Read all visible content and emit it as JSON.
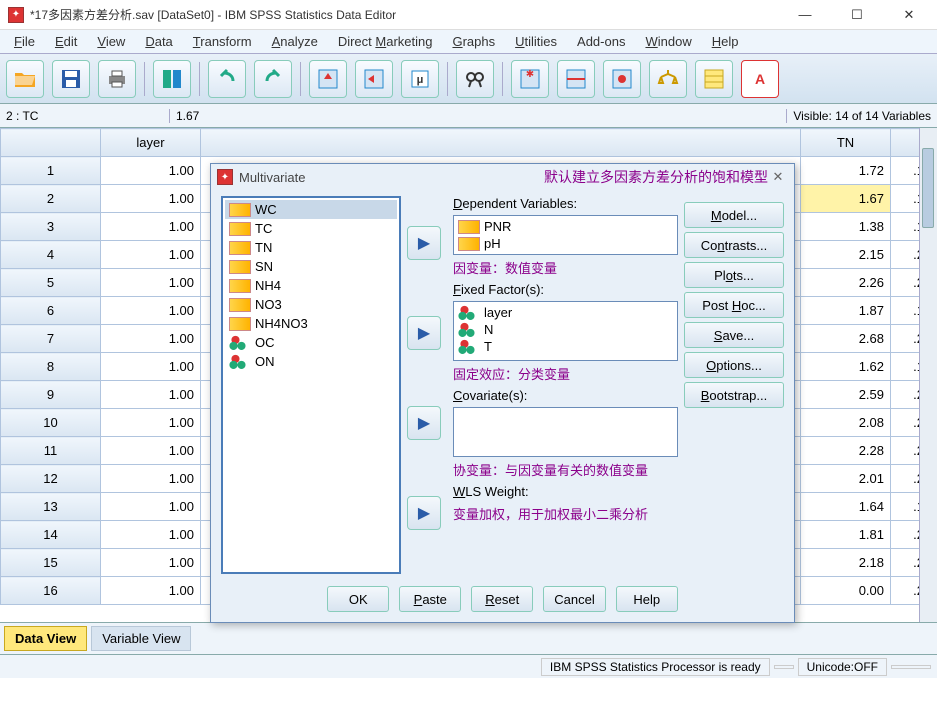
{
  "title": "*17多因素方差分析.sav [DataSet0] - IBM SPSS Statistics Data Editor",
  "menu": [
    "File",
    "Edit",
    "View",
    "Data",
    "Transform",
    "Analyze",
    "Direct Marketing",
    "Graphs",
    "Utilities",
    "Add-ons",
    "Window",
    "Help"
  ],
  "menu_ul": [
    "F",
    "E",
    "V",
    "D",
    "T",
    "A",
    "M",
    "G",
    "U",
    "",
    "W",
    "H"
  ],
  "cellref": "2 : TC",
  "cellval": "1.67",
  "visible": "Visible: 14 of 14 Variables",
  "cols": [
    "layer",
    "TN"
  ],
  "rows": [
    {
      "n": "1",
      "layer": "1.00",
      "tn": "1.72",
      "ext": ".1"
    },
    {
      "n": "2",
      "layer": "1.00",
      "tn": "1.67",
      "ext": ".1",
      "sel": true
    },
    {
      "n": "3",
      "layer": "1.00",
      "tn": "1.38",
      "ext": ".1"
    },
    {
      "n": "4",
      "layer": "1.00",
      "tn": "2.15",
      "ext": ".2"
    },
    {
      "n": "5",
      "layer": "1.00",
      "tn": "2.26",
      "ext": ".2"
    },
    {
      "n": "6",
      "layer": "1.00",
      "tn": "1.87",
      "ext": ".1"
    },
    {
      "n": "7",
      "layer": "1.00",
      "tn": "2.68",
      "ext": ".2"
    },
    {
      "n": "8",
      "layer": "1.00",
      "tn": "1.62",
      "ext": ".1"
    },
    {
      "n": "9",
      "layer": "1.00",
      "tn": "2.59",
      "ext": ".2"
    },
    {
      "n": "10",
      "layer": "1.00",
      "tn": "2.08",
      "ext": ".2"
    },
    {
      "n": "11",
      "layer": "1.00",
      "tn": "2.28",
      "ext": ".2"
    },
    {
      "n": "12",
      "layer": "1.00",
      "tn": "2.01",
      "ext": ".2"
    },
    {
      "n": "13",
      "layer": "1.00",
      "tn": "1.64",
      "ext": ".1"
    },
    {
      "n": "14",
      "layer": "1.00",
      "tn": "1.81",
      "ext": ".2"
    },
    {
      "n": "15",
      "layer": "1.00",
      "tn": "2.18",
      "ext": ".2"
    },
    {
      "n": "16",
      "layer": "1.00",
      "tn": "0.00",
      "ext": ".2"
    }
  ],
  "viewtabs": {
    "data": "Data View",
    "var": "Variable View"
  },
  "status": {
    "proc": "IBM SPSS Statistics Processor is ready",
    "unicode": "Unicode:OFF"
  },
  "dialog": {
    "title": "Multivariate",
    "annot_title": "默认建立多因素方差分析的饱和模型",
    "src": [
      {
        "name": "WC",
        "t": "ruler",
        "sel": true
      },
      {
        "name": "TC",
        "t": "ruler"
      },
      {
        "name": "TN",
        "t": "ruler"
      },
      {
        "name": "SN",
        "t": "ruler"
      },
      {
        "name": "NH4",
        "t": "ruler"
      },
      {
        "name": "NO3",
        "t": "ruler"
      },
      {
        "name": "NH4NO3",
        "t": "ruler"
      },
      {
        "name": "OC",
        "t": "balls"
      },
      {
        "name": "ON",
        "t": "balls"
      }
    ],
    "dep_label": "Dependent Variables:",
    "dep": [
      {
        "name": "PNR",
        "t": "ruler"
      },
      {
        "name": "pH",
        "t": "ruler"
      }
    ],
    "dep_annot": "因变量：数值变量",
    "ff_label": "Fixed Factor(s):",
    "ff": [
      {
        "name": "layer",
        "t": "balls"
      },
      {
        "name": "N",
        "t": "balls"
      },
      {
        "name": "T",
        "t": "balls"
      }
    ],
    "ff_annot": "固定效应：分类变量",
    "cov_label": "Covariate(s):",
    "cov_annot": "协变量：与因变量有关的数值变量",
    "wls_label": "WLS Weight:",
    "wls_annot": "变量加权，用于加权最小二乘分析",
    "btns": {
      "model": "Model...",
      "contrasts": "Contrasts...",
      "plots": "Plots...",
      "posthoc": "Post Hoc...",
      "save": "Save...",
      "options": "Options...",
      "bootstrap": "Bootstrap..."
    },
    "footer": {
      "ok": "OK",
      "paste": "Paste",
      "reset": "Reset",
      "cancel": "Cancel",
      "help": "Help"
    }
  }
}
